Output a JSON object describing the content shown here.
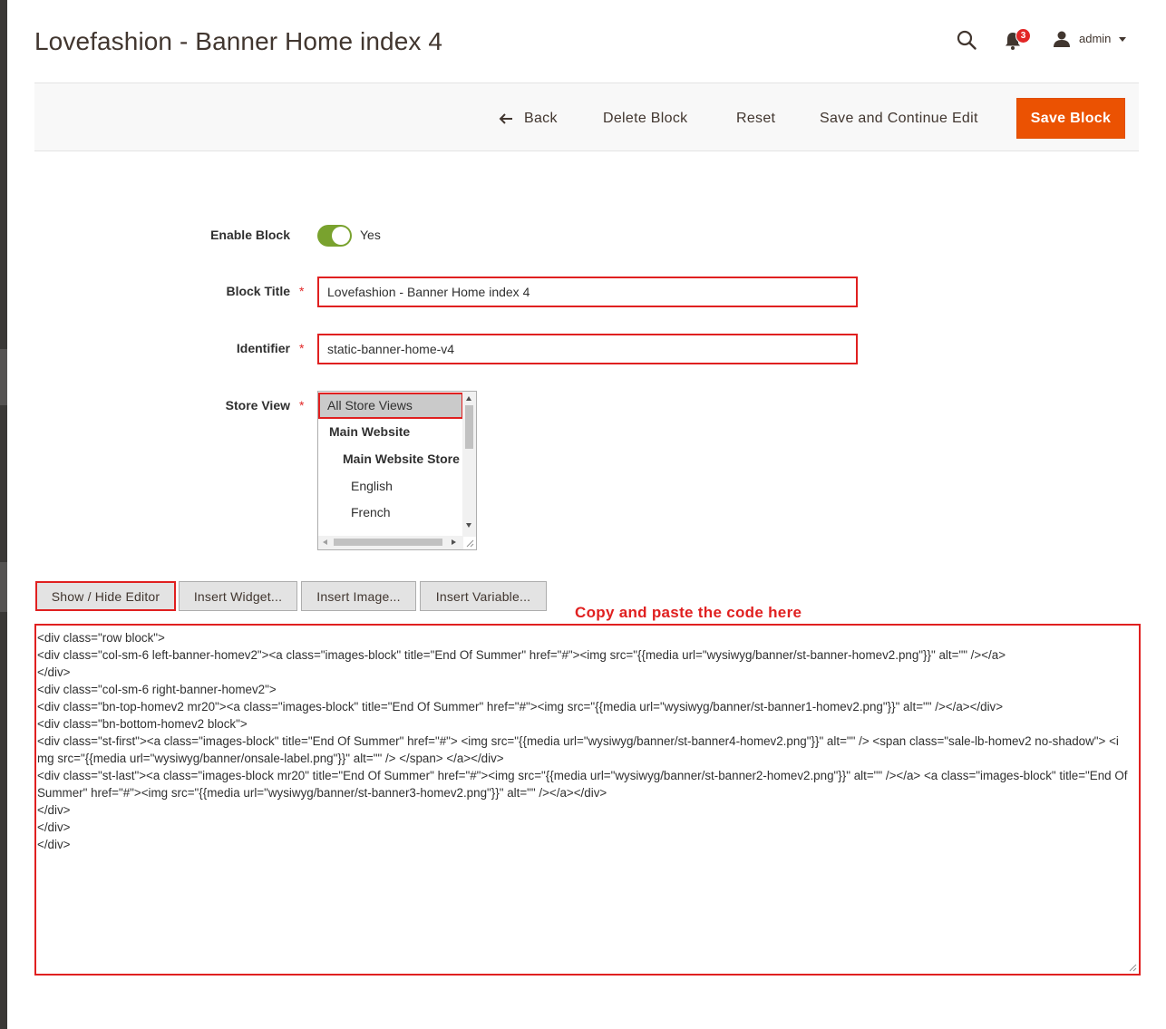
{
  "page": {
    "title": "Lovefashion - Banner Home index 4"
  },
  "header": {
    "notification_count": "3",
    "user_name": "admin"
  },
  "toolbar": {
    "back_label": "Back",
    "delete_label": "Delete Block",
    "reset_label": "Reset",
    "save_continue_label": "Save and Continue Edit",
    "save_label": "Save Block",
    "save_color": "#eb5202"
  },
  "form": {
    "enable": {
      "label": "Enable Block",
      "value": "Yes",
      "toggle_color": "#79a22e"
    },
    "title": {
      "label": "Block Title",
      "required": "*",
      "value": "Lovefashion - Banner Home index 4"
    },
    "identifier": {
      "label": "Identifier",
      "required": "*",
      "value": "static-banner-home-v4"
    },
    "store_view": {
      "label": "Store View",
      "required": "*",
      "options": [
        "All Store Views",
        "Main Website",
        "Main Website Store",
        "English",
        "French"
      ],
      "selected": "All Store Views"
    }
  },
  "editor": {
    "buttons": {
      "show_hide": "Show / Hide Editor",
      "insert_widget": "Insert Widget...",
      "insert_image": "Insert Image...",
      "insert_variable": "Insert Variable..."
    },
    "annotation": "Copy and paste the code here",
    "annotation_color": "#e02020",
    "content_lines": [
      "<div class=\"row block\">",
      "<div class=\"col-sm-6 left-banner-homev2\"><a class=\"images-block\" title=\"End Of Summer\" href=\"#\"><img src=\"{{media url=\"wysiwyg/banner/st-banner-homev2.png\"}}\" alt=\"\" /></a>",
      "</div>",
      "<div class=\"col-sm-6 right-banner-homev2\">",
      "<div class=\"bn-top-homev2 mr20\"><a class=\"images-block\" title=\"End Of Summer\" href=\"#\"><img src=\"{{media url=\"wysiwyg/banner/st-banner1-homev2.png\"}}\" alt=\"\" /></a></div>",
      "<div class=\"bn-bottom-homev2 block\">",
      "<div class=\"st-first\"><a class=\"images-block\" title=\"End Of Summer\" href=\"#\"> <img src=\"{{media url=\"wysiwyg/banner/st-banner4-homev2.png\"}}\" alt=\"\" /> <span class=\"sale-lb-homev2 no-shadow\"> <img src=\"{{media url=\"wysiwyg/banner/onsale-label.png\"}}\" alt=\"\" /> </span> </a></div>",
      "<div class=\"st-last\"><a class=\"images-block mr20\" title=\"End Of Summer\" href=\"#\"><img src=\"{{media url=\"wysiwyg/banner/st-banner2-homev2.png\"}}\" alt=\"\" /></a> <a class=\"images-block\" title=\"End Of Summer\" href=\"#\"><img src=\"{{media url=\"wysiwyg/banner/st-banner3-homev2.png\"}}\" alt=\"\" /></a></div>",
      "</div>",
      "</div>",
      "</div>"
    ]
  }
}
